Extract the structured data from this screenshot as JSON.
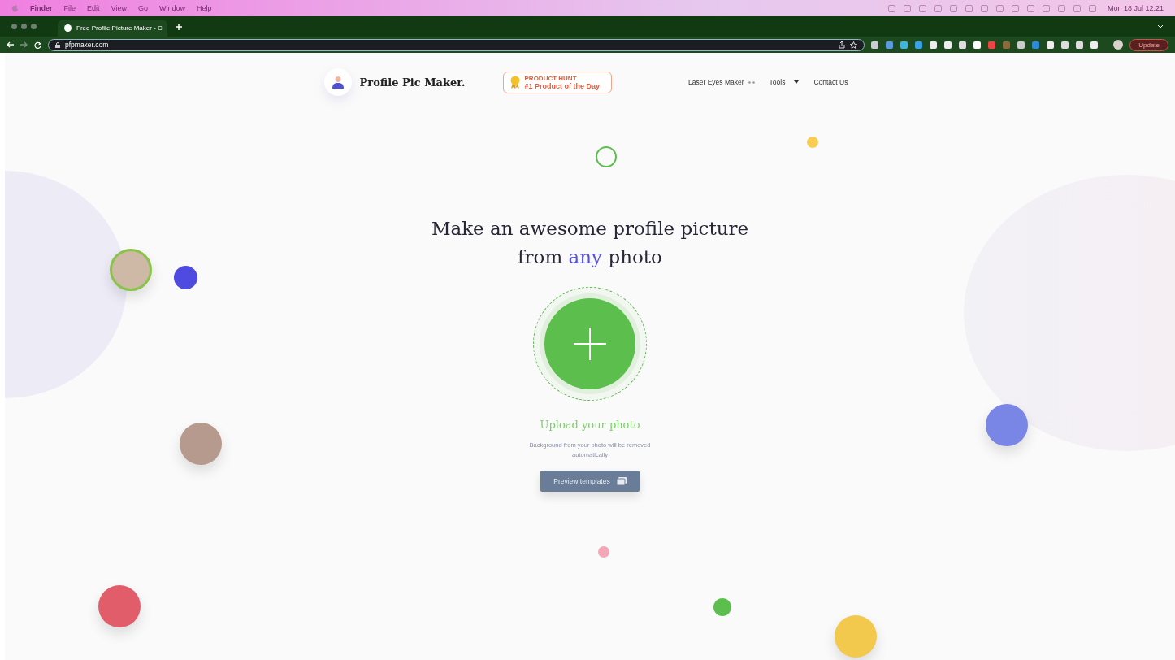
{
  "menu_bar": {
    "items": [
      "Finder",
      "File",
      "Edit",
      "View",
      "Go",
      "Window",
      "Help"
    ],
    "clock": "Mon 18 Jul 12:21"
  },
  "browser": {
    "tab": {
      "title": "Free Profile Picture Maker - C"
    },
    "address": "pfpmaker.com",
    "update_button": "Update"
  },
  "site": {
    "logo": "Profile Pic Maker.",
    "badge": {
      "kicker": "PRODUCT HUNT",
      "label": "#1 Product of the Day"
    },
    "nav": [
      {
        "label": "Laser Eyes Maker",
        "kind": "eyes"
      },
      {
        "label": "Tools",
        "kind": "dropdown"
      },
      {
        "label": "Contact Us",
        "kind": "link"
      }
    ]
  },
  "hero": {
    "heading_line1": "Make an awesome profile picture",
    "heading_before": "from",
    "heading_highlight": "any",
    "heading_after": "photo",
    "upload_label": "Upload your photo",
    "note": "Background from your photo will be removed automatically",
    "preview_button": "Preview templates"
  }
}
